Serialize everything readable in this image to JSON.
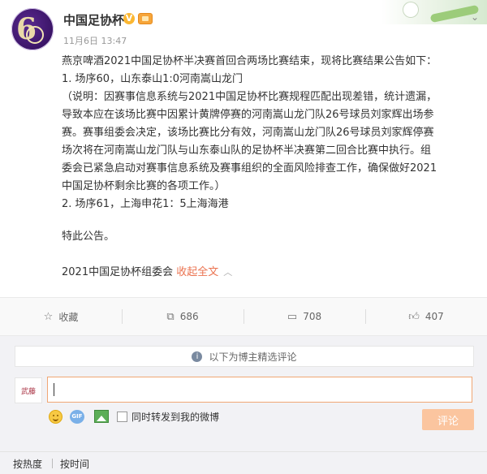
{
  "post": {
    "author": "中国足协杯",
    "timestamp": "11月6日 13:47",
    "lines": [
      "燕京啤酒2021中国足协杯半决赛首回合两场比赛结束，现将比赛结果公告如下：",
      "1. 场序60，山东泰山1:0河南嵩山龙门",
      "（说明：因赛事信息系统与2021中国足协杯比赛规程匹配出现差错，统计遗漏，",
      "导致本应在该场比赛中因累计黄牌停赛的河南嵩山龙门队26号球员刘家辉出场参",
      "赛。赛事组委会决定，该场比赛比分有效，河南嵩山龙门队26号球员刘家辉停赛",
      "场次将在河南嵩山龙门队与山东泰山队的足协杯半决赛第二回合比赛中执行。组",
      "委会已紧急启动对赛事信息系统及赛事组织的全面风险排查工作，确保做好2021",
      "中国足协杯剩余比赛的各项工作。）",
      "2. 场序61，上海申花1：5上海海港"
    ],
    "notice": "特此公告。",
    "signature": "2021中国足协杯组委会",
    "collapse_label": "收起全文",
    "collapse_arrow": "︿",
    "avatar_mark": "65"
  },
  "actions": {
    "favorite": {
      "label": "收藏",
      "icon": "star-icon"
    },
    "repost": {
      "count": "686",
      "icon": "repost-icon"
    },
    "comment": {
      "count": "708",
      "icon": "comment-icon"
    },
    "like": {
      "count": "407",
      "icon": "thumbs-up-icon"
    }
  },
  "comments": {
    "tip": "以下为博主精选评论",
    "my_avatar_text": "武藤",
    "repost_checkbox_label": "同时转发到我的微博",
    "submit_label": "评论",
    "gif_label": "GIF"
  },
  "sort": {
    "by_hot": "按热度",
    "by_time": "按时间"
  },
  "colors": {
    "accent": "#eb7350",
    "submit_bg": "#fbc59f",
    "input_border": "#f0a674"
  }
}
